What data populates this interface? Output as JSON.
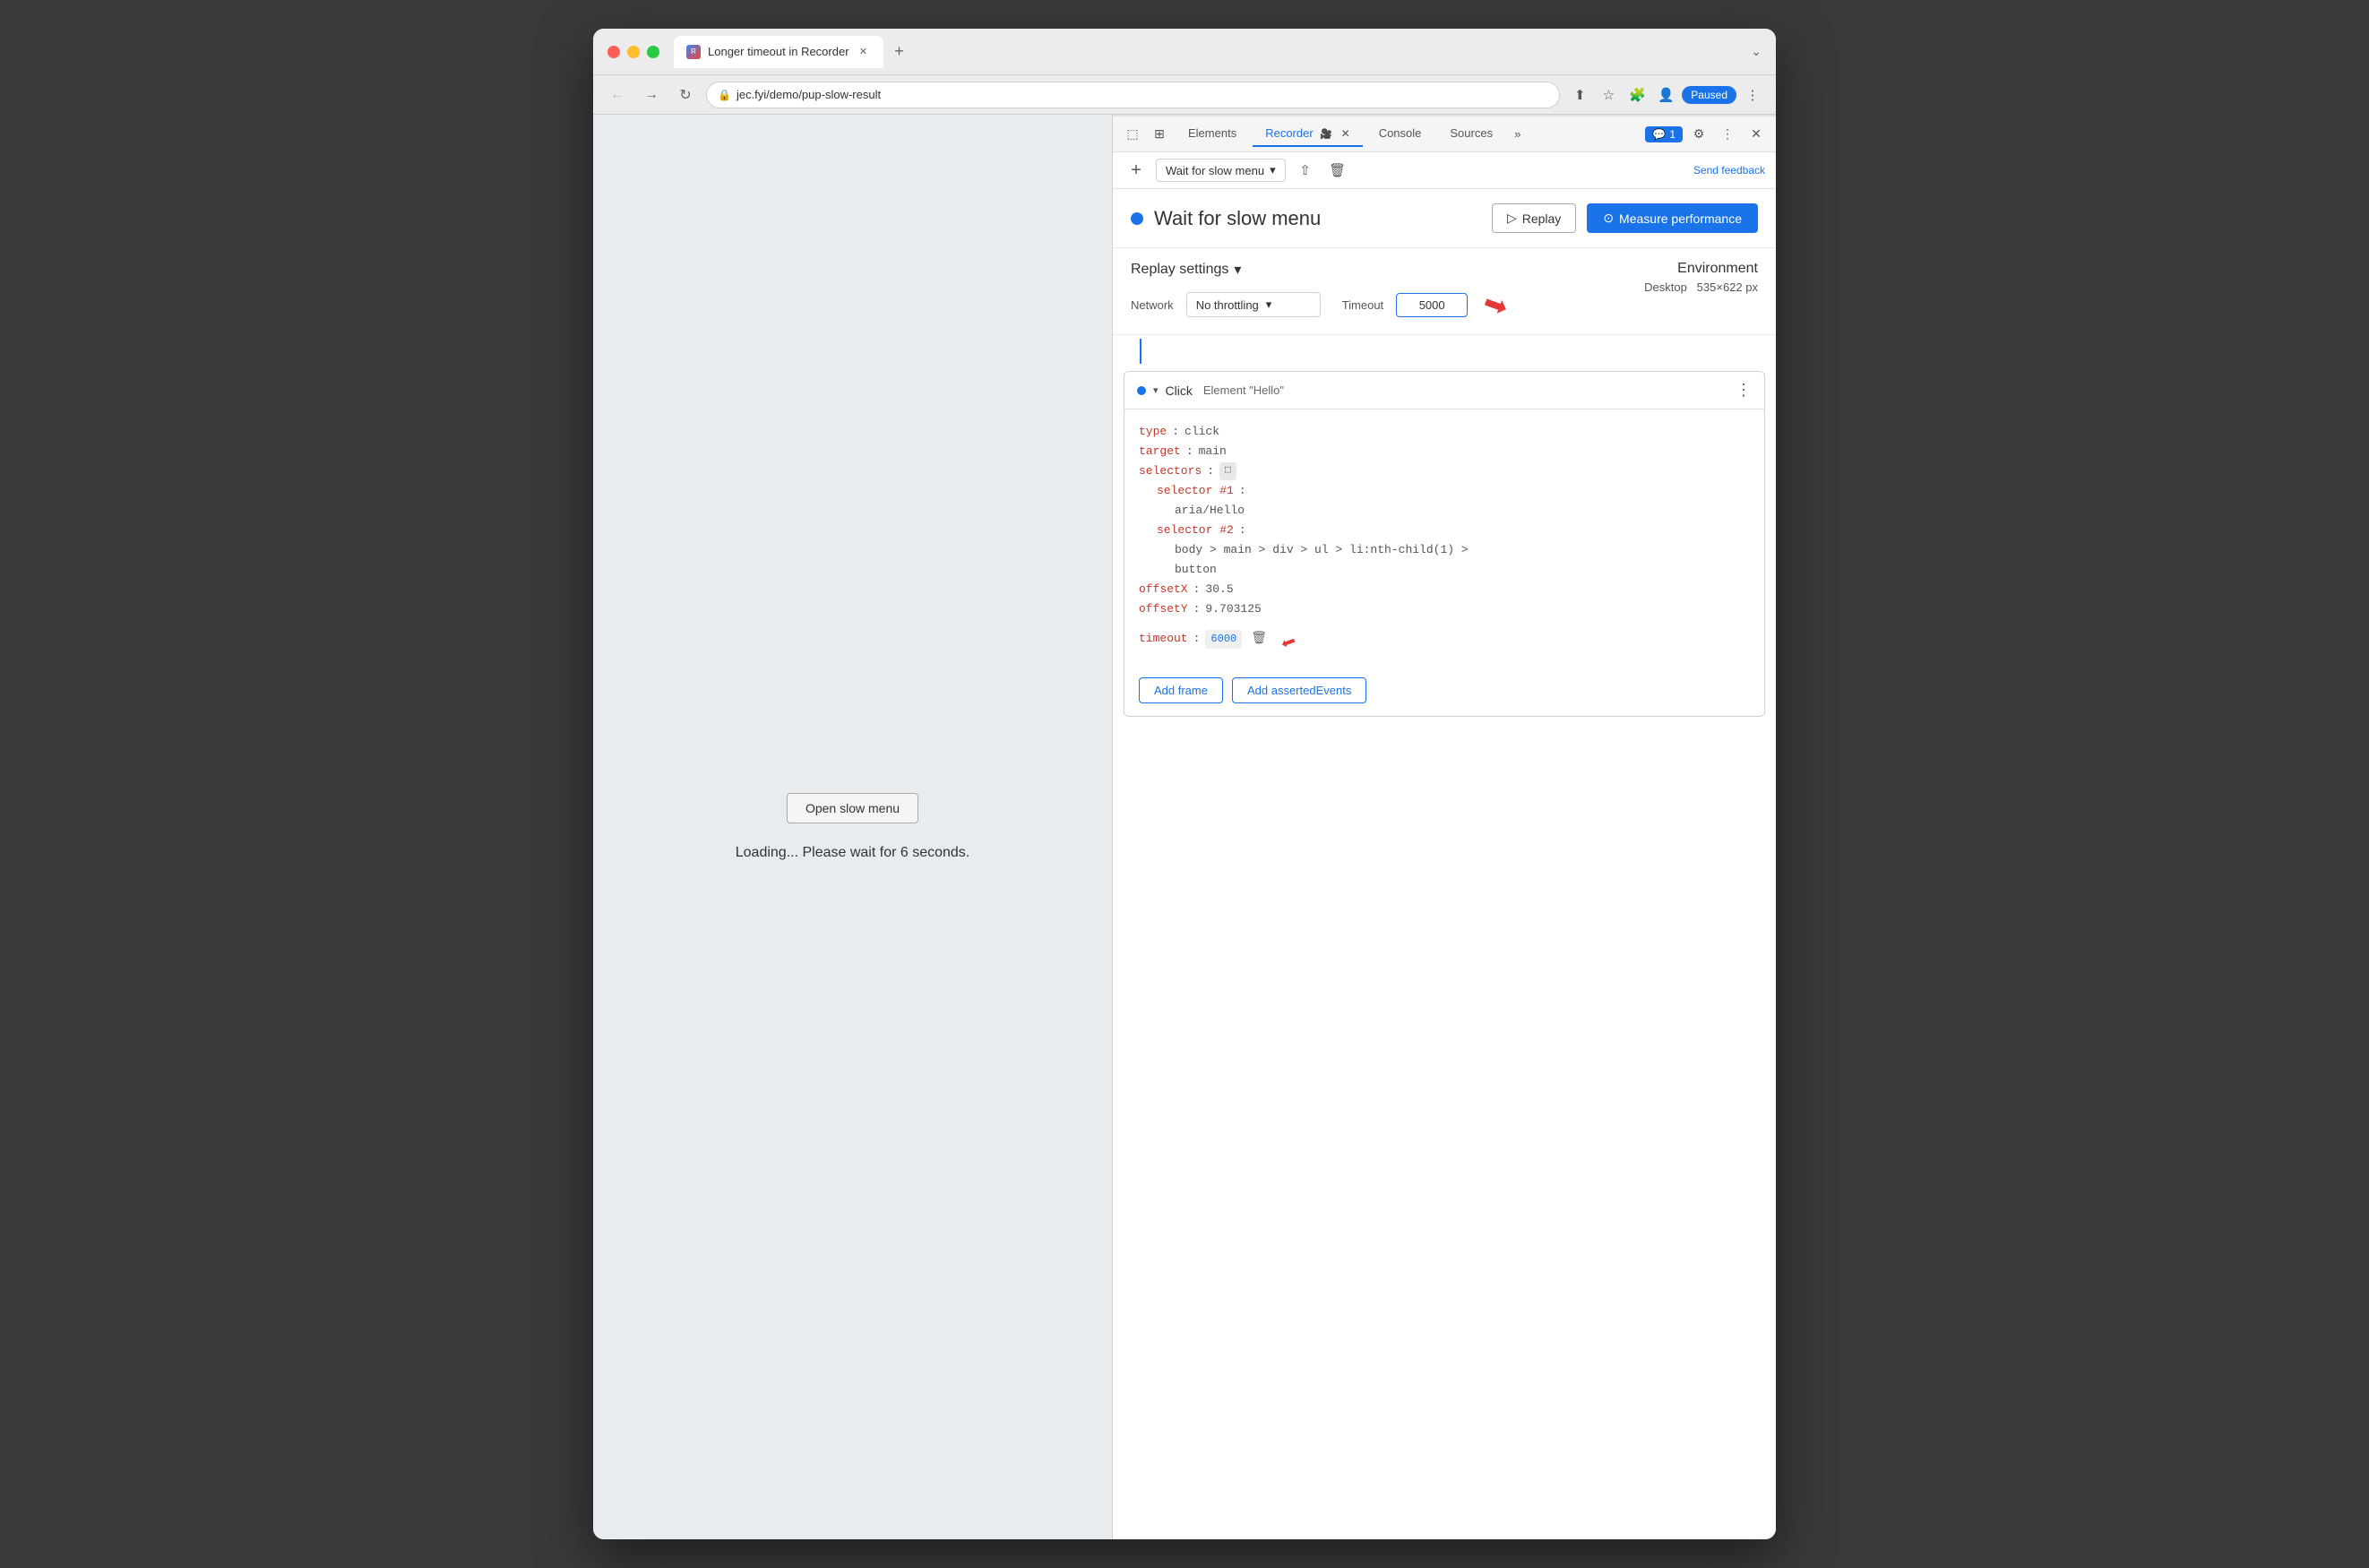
{
  "window": {
    "title": "Longer timeout in Recorder"
  },
  "browser": {
    "url": "jec.fyi/demo/pup-slow-result",
    "tab_label": "Longer timeout in Recorder",
    "profile_label": "Paused"
  },
  "page_content": {
    "open_menu_btn": "Open slow menu",
    "loading_text": "Loading... Please wait for 6 seconds."
  },
  "devtools": {
    "tabs": [
      "Elements",
      "Recorder",
      "Console",
      "Sources"
    ],
    "active_tab": "Recorder",
    "send_feedback": "Send feedback",
    "chat_badge": "1",
    "toolbar": {
      "recording_name": "Wait for slow menu",
      "add_btn": "+",
      "upload_icon": "⬆",
      "delete_icon": "🗑"
    },
    "recording": {
      "title": "Wait for slow menu",
      "replay_btn": "Replay",
      "measure_btn": "Measure performance"
    },
    "replay_settings": {
      "title": "Replay settings",
      "network_label": "Network",
      "network_value": "No throttling",
      "timeout_label": "Timeout",
      "timeout_value": "5000"
    },
    "environment": {
      "title": "Environment",
      "value": "Desktop",
      "dimensions": "535×622 px"
    },
    "event": {
      "type": "Click",
      "detail": "Element \"Hello\"",
      "code": {
        "type_label": "type",
        "type_value": "click",
        "target_label": "target",
        "target_value": "main",
        "selectors_label": "selectors",
        "selector1_label": "selector #1",
        "selector1_value": "aria/Hello",
        "selector2_label": "selector #2",
        "selector2_value": "body > main > div > ul > li:nth-child(1) >",
        "selector2_value2": "button",
        "offsetX_label": "offsetX",
        "offsetX_value": "30.5",
        "offsetY_label": "offsetY",
        "offsetY_value": "9.703125",
        "timeout_label": "timeout",
        "timeout_value": "6000"
      },
      "add_frame_btn": "Add frame",
      "add_asserted_btn": "Add assertedEvents"
    }
  }
}
